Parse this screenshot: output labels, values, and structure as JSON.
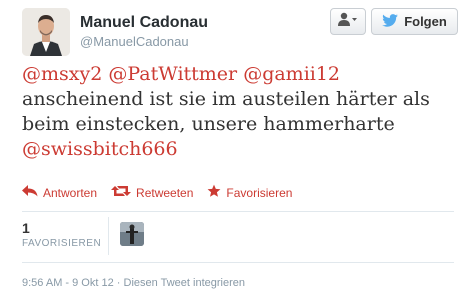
{
  "author": {
    "name": "Manuel Cadonau",
    "handle": "@ManuelCadonau"
  },
  "buttons": {
    "follow_label": "Folgen"
  },
  "tweet": {
    "mention1": "@msxy2",
    "mention2": "@PatWittmer",
    "mention3": "@gamii12",
    "body": "anscheinend ist sie im austeilen härter als beim einstecken, unsere hammerharte",
    "mention4": "@swissbitch666"
  },
  "actions": {
    "reply": "Antworten",
    "retweet": "Retweeten",
    "favorite": "Favorisieren"
  },
  "stats": {
    "favorites_count": "1",
    "favorites_label": "FAVORISIEREN"
  },
  "meta": {
    "timestamp": "9:56 AM - 9 Okt 12",
    "separator": "·",
    "embed": "Diesen Tweet integrieren"
  },
  "colors": {
    "accent": "#cc3b33",
    "twitter_blue": "#55acee",
    "muted": "#8899a6"
  }
}
